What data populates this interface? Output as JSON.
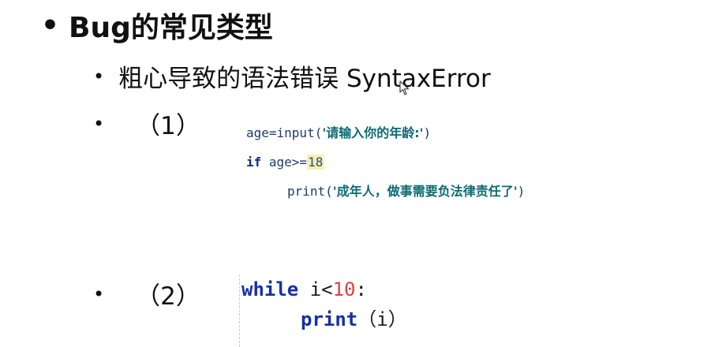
{
  "slide": {
    "title_bullet": "•",
    "title": "Bug的常见类型",
    "sub_bullet": "•",
    "sub_title": "粗心导致的语法错误 SyntaxError",
    "items": [
      {
        "bullet": "•",
        "label": "（1）"
      },
      {
        "bullet": "•",
        "label": "（2）"
      }
    ]
  },
  "code1": {
    "line1_pre": "age=input(",
    "line1_str": "'请输入你的年龄:'",
    "line1_post": ")",
    "line2_kw": "if",
    "line2_mid": " age>=",
    "line2_num": "18",
    "line3_pre": "print(",
    "line3_str": "'成年人，做事需要负法律责任了'",
    "line3_post": ")"
  },
  "code2": {
    "line1_kw": "while",
    "line1_mid": " i<",
    "line1_num": "10",
    "line1_post": ":",
    "line2_kw": "print",
    "line2_post": "（i）"
  },
  "colors": {
    "keyword": "#1530a8",
    "string": "#0b6b73",
    "number_red": "#e04040",
    "highlight": "#f9efa6"
  }
}
